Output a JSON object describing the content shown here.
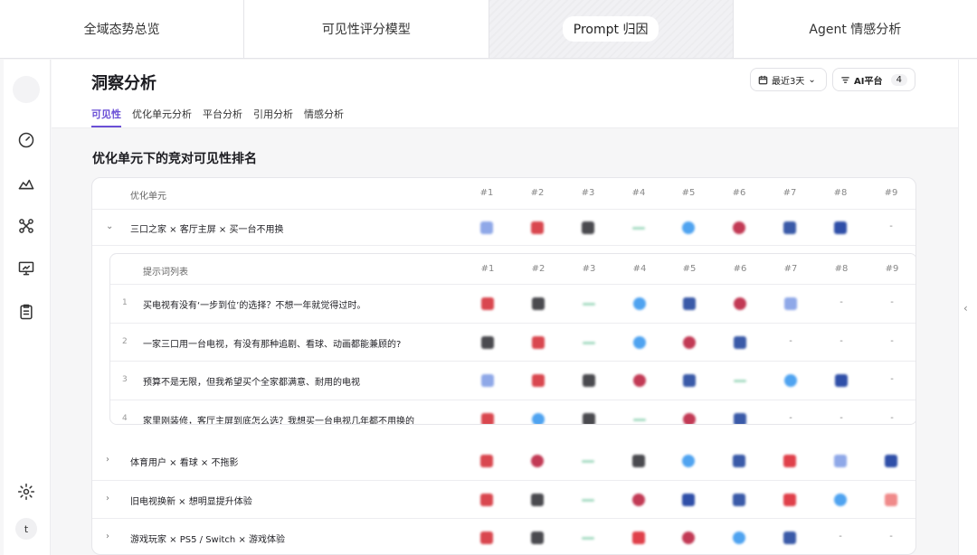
{
  "top_tabs": [
    "全域态势总览",
    "可见性评分模型",
    "Prompt 归因",
    "Agent 情感分析"
  ],
  "active_top_tab": 2,
  "header": {
    "title": "洞察分析",
    "sub_tabs": [
      "可见性",
      "优化单元分析",
      "平台分析",
      "引用分析",
      "情感分析"
    ],
    "active_sub_tab": 0,
    "date_button": "最近3天",
    "ai_button": "AI平台",
    "ai_count": "4"
  },
  "rail": {
    "avatar": "t"
  },
  "section_title": "优化单元下的竞对可见性排名",
  "table": {
    "unit_header": "优化单元",
    "rank_headers": [
      "#1",
      "#2",
      "#3",
      "#4",
      "#5",
      "#6",
      "#7",
      "#8",
      "#9"
    ],
    "expanded_unit": {
      "label": "三口之家 × 客厅主屏 × 买一台不用换",
      "cells": [
        "blue-sq",
        "red-sq",
        "dark-sq",
        "dash",
        "blue-round",
        "red-round",
        "navy-sq",
        "p-logo",
        "-"
      ]
    },
    "sub_header": "提示词列表",
    "prompts": [
      {
        "num": "1",
        "label": "买电视有没有‘一步到位’的选择？不想一年就觉得过时。",
        "cells": [
          "red-sq",
          "dark-sq",
          "dash",
          "blue-round",
          "navy-sq",
          "red-round",
          "blue-sq",
          "-",
          "-"
        ]
      },
      {
        "num": "2",
        "label": "一家三口用一台电视，有没有那种追剧、看球、动画都能兼顾的?",
        "cells": [
          "dark-sq",
          "red-sq",
          "dash",
          "blue-round",
          "red-round",
          "navy-sq",
          "-",
          "-",
          "-"
        ]
      },
      {
        "num": "3",
        "label": "预算不是无限，但我希望买个全家都满意、耐用的电视",
        "cells": [
          "blue-sq",
          "red-sq",
          "dark-sq",
          "red-round",
          "navy-sq",
          "dash",
          "blue-round",
          "p-logo",
          "-"
        ]
      },
      {
        "num": "4",
        "label": "家里刚装修，客厅主屏到底怎么选？我想买一台电视几年都不用换的",
        "cells": [
          "red-sq",
          "blue-round",
          "dark-sq",
          "dash",
          "red-round",
          "navy-sq",
          "-",
          "-",
          "-"
        ]
      }
    ],
    "collapsed_units": [
      {
        "label": "体育用户 × 看球 × 不拖影",
        "cells": [
          "red-sq",
          "red-round",
          "dash",
          "dark-sq",
          "blue-round",
          "navy-sq",
          "t-logo",
          "blue-sq",
          "p-logo"
        ]
      },
      {
        "label": "旧电视换新 × 想明显提升体验",
        "cells": [
          "red-sq",
          "dark-sq",
          "dash",
          "red-round",
          "p-logo",
          "navy-sq",
          "t-logo",
          "blue-round",
          "red-sq-light"
        ]
      },
      {
        "label": "游戏玩家 × PS5 / Switch × 游戏体验",
        "cells": [
          "red-sq",
          "dark-sq",
          "dash",
          "t-logo",
          "red-round",
          "blue-round",
          "navy-sq",
          "-",
          "-"
        ]
      }
    ]
  },
  "logo_colors": {
    "blue-sq": "#8fa8e8",
    "red-sq": "#d9474f",
    "red-sq-light": "#f08a8a",
    "dark-sq": "#4a4a4f",
    "dash": "#a8dcc4",
    "blue-round": "#4fa3f0",
    "red-round": "#c23a55",
    "navy-sq": "#3a5aa8",
    "p-logo": "#2f4fa8",
    "t-logo": "#e0404a"
  }
}
